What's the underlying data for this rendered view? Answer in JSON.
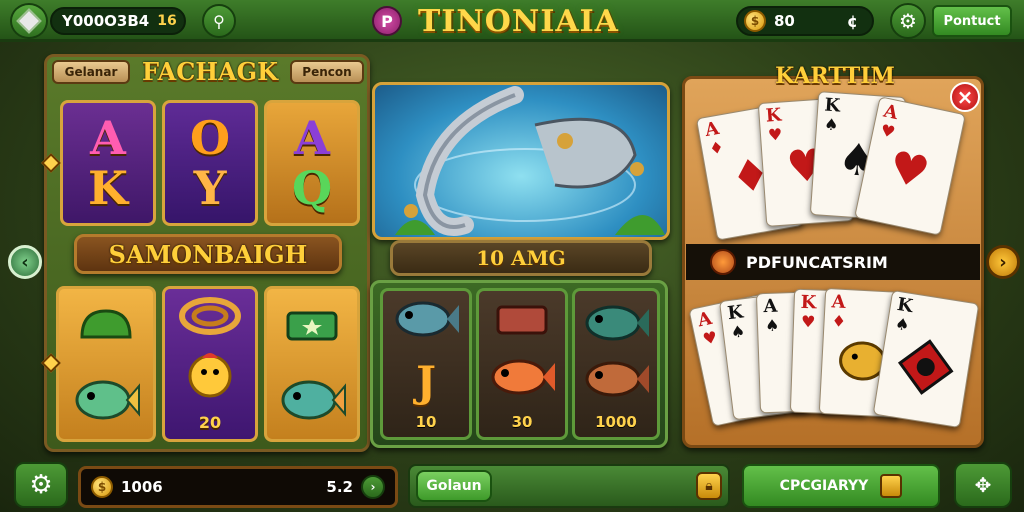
{
  "top_bar": {
    "gem_balance": "Y000O3B4",
    "gem_badge": "16",
    "key_icon": "key-icon",
    "help_symbol": "P",
    "game_title": "TINONIAIA",
    "coin_balance": "80",
    "coin_symbol": "¢",
    "settings_icon": "gear-icon",
    "account_button": "Pontuct"
  },
  "slot_panel": {
    "left_label": "Gelanar",
    "title": "FACHAGK",
    "right_label": "Pencon",
    "reel_top": [
      "A K",
      "O Y",
      "A Q"
    ],
    "mid_banner": "SAMONBAIGH",
    "reel_bottom_values": [
      "",
      "20",
      ""
    ]
  },
  "hook_panel": {
    "value": "10 AMG"
  },
  "fish_grid": {
    "values": [
      "10",
      "30",
      "1000"
    ]
  },
  "card_panel": {
    "title": "KARTTIM",
    "close_symbol": "×",
    "banner": "PDFUNCATSRIM",
    "top_cards": [
      {
        "rank": "A",
        "suit": "♦",
        "color": "#c21818"
      },
      {
        "rank": "K",
        "suit": "♥",
        "color": "#c21818"
      },
      {
        "rank": "K",
        "suit": "♠",
        "color": "#111111"
      },
      {
        "rank": "A",
        "suit": "♥",
        "color": "#c21818"
      }
    ],
    "bottom_cards": [
      {
        "rank": "A",
        "suit": "♥",
        "color": "#c21818"
      },
      {
        "rank": "K",
        "suit": "♠",
        "color": "#111111"
      },
      {
        "rank": "A",
        "suit": "♠",
        "color": "#111111"
      },
      {
        "rank": "K",
        "suit": "♥",
        "color": "#c21818"
      },
      {
        "rank": "A",
        "suit": "♦",
        "color": "#c21818"
      },
      {
        "rank": "K",
        "suit": "♠",
        "color": "#111111"
      }
    ]
  },
  "nav": {
    "left_arrow": "‹",
    "right_arrow": "›"
  },
  "bottom_bar": {
    "settings_icon": "gear-icon",
    "balance": "1006",
    "bet_value": "5.2",
    "action_label": "Golaun",
    "lock_icon": "lock-icon",
    "collect_label": "CPCGIARYY",
    "menu_icon": "controller-icon"
  },
  "colors": {
    "accent_green": "#3e7d2a",
    "gold": "#ffcf3a",
    "wood": "#7a4a1c"
  }
}
